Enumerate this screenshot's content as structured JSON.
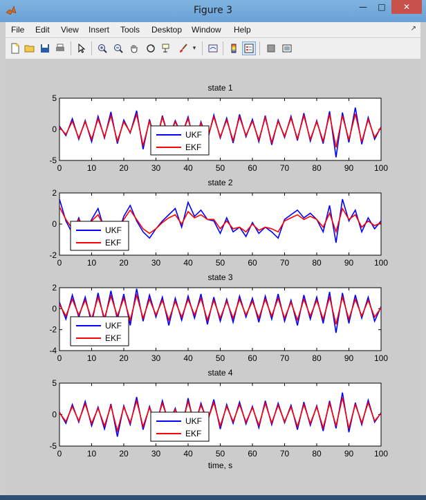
{
  "window": {
    "title": "Figure 3"
  },
  "menubar": {
    "items": [
      "File",
      "Edit",
      "View",
      "Insert",
      "Tools",
      "Desktop",
      "Window",
      "Help"
    ]
  },
  "toolbar": {
    "icons": [
      "new-figure-icon",
      "open-file-icon",
      "save-icon",
      "print-icon",
      "edit-plot-arrow-icon",
      "zoom-in-icon",
      "zoom-out-icon",
      "pan-hand-icon",
      "rotate-3d-icon",
      "data-cursor-icon",
      "brush-icon",
      "brush-dropdown-icon",
      "link-plot-icon",
      "insert-colorbar-icon",
      "insert-legend-icon",
      "hide-plot-tools-icon",
      "show-plot-tools-icon"
    ]
  },
  "colors": {
    "ukf": "#0000ff",
    "ekf": "#ff0000",
    "figure_bg": "#cccccc",
    "axes_bg": "#ffffff"
  },
  "chart_data": [
    {
      "type": "line",
      "title": "state 1",
      "xlabel": "",
      "xlim": [
        0,
        100
      ],
      "ylim": [
        -5,
        5
      ],
      "xticks": [
        0,
        10,
        20,
        30,
        40,
        50,
        60,
        70,
        80,
        90,
        100
      ],
      "yticks": [
        -5,
        0,
        5
      ],
      "legend": {
        "placement": "bottom-center"
      },
      "series": [
        {
          "name": "UKF",
          "color": "#0000ff",
          "x": [
            0,
            2,
            4,
            6,
            8,
            10,
            12,
            14,
            16,
            18,
            20,
            22,
            24,
            26,
            28,
            30,
            32,
            34,
            36,
            38,
            40,
            42,
            44,
            46,
            48,
            50,
            52,
            54,
            56,
            58,
            60,
            62,
            64,
            66,
            68,
            70,
            72,
            74,
            76,
            78,
            80,
            82,
            84,
            86,
            88,
            90,
            92,
            94,
            96,
            98,
            100
          ],
          "values": [
            0.5,
            -1.0,
            1.7,
            -1.6,
            1.4,
            -2.0,
            2.1,
            -1.4,
            2.8,
            -2.3,
            1.5,
            -0.6,
            3.0,
            -3.2,
            1.6,
            -2.4,
            2.2,
            -1.5,
            1.4,
            -1.0,
            2.0,
            -2.6,
            1.2,
            -1.8,
            2.3,
            -1.4,
            1.8,
            -2.2,
            2.4,
            -1.2,
            1.6,
            -2.0,
            2.2,
            -2.5,
            1.5,
            -1.3,
            2.1,
            -1.8,
            2.6,
            -1.9,
            1.4,
            -2.3,
            2.9,
            -4.5,
            2.7,
            -2.1,
            3.5,
            -2.4,
            1.9,
            -1.6,
            0.4
          ]
        },
        {
          "name": "EKF",
          "color": "#ff0000",
          "x": [
            0,
            2,
            4,
            6,
            8,
            10,
            12,
            14,
            16,
            18,
            20,
            22,
            24,
            26,
            28,
            30,
            32,
            34,
            36,
            38,
            40,
            42,
            44,
            46,
            48,
            50,
            52,
            54,
            56,
            58,
            60,
            62,
            64,
            66,
            68,
            70,
            72,
            74,
            76,
            78,
            80,
            82,
            84,
            86,
            88,
            90,
            92,
            94,
            96,
            98,
            100
          ],
          "values": [
            0.3,
            -0.8,
            1.3,
            -1.4,
            1.2,
            -1.6,
            1.7,
            -1.2,
            2.2,
            -1.9,
            1.2,
            -0.5,
            2.4,
            -2.6,
            1.3,
            -2.0,
            1.9,
            -1.3,
            1.2,
            -0.8,
            1.7,
            -2.1,
            1.0,
            -1.5,
            2.0,
            -1.2,
            1.5,
            -1.8,
            2.0,
            -1.0,
            1.3,
            -1.7,
            1.9,
            -2.1,
            1.3,
            -1.1,
            1.8,
            -1.5,
            2.2,
            -1.6,
            1.2,
            -1.9,
            2.4,
            -2.9,
            2.2,
            -1.7,
            2.5,
            -2.0,
            1.6,
            -1.3,
            0.3
          ]
        }
      ]
    },
    {
      "type": "line",
      "title": "state 2",
      "xlabel": "",
      "xlim": [
        0,
        100
      ],
      "ylim": [
        -2,
        2
      ],
      "xticks": [
        0,
        10,
        20,
        30,
        40,
        50,
        60,
        70,
        80,
        90,
        100
      ],
      "yticks": [
        -2,
        0,
        2
      ],
      "legend": {
        "placement": "bottom-left"
      },
      "series": [
        {
          "name": "UKF",
          "color": "#0000ff",
          "x": [
            0,
            2,
            4,
            6,
            8,
            10,
            12,
            14,
            16,
            18,
            20,
            22,
            24,
            26,
            28,
            30,
            32,
            34,
            36,
            38,
            40,
            42,
            44,
            46,
            48,
            50,
            52,
            54,
            56,
            58,
            60,
            62,
            64,
            66,
            68,
            70,
            72,
            74,
            76,
            78,
            80,
            82,
            84,
            86,
            88,
            90,
            92,
            94,
            96,
            98,
            100
          ],
          "values": [
            1.6,
            0.2,
            -0.6,
            0.4,
            -0.7,
            0.3,
            1.0,
            -0.4,
            -0.2,
            -0.8,
            0.5,
            1.2,
            0.2,
            -0.5,
            -0.9,
            -0.3,
            0.2,
            0.6,
            1.0,
            -0.2,
            1.4,
            0.5,
            0.9,
            0.3,
            0.2,
            -0.6,
            0.4,
            -0.5,
            -0.2,
            -0.8,
            0.1,
            -0.6,
            -0.2,
            -0.5,
            -0.9,
            0.3,
            0.6,
            0.9,
            0.4,
            0.7,
            0.3,
            -0.5,
            1.2,
            -1.2,
            1.6,
            0.2,
            0.9,
            -0.5,
            0.4,
            -0.3,
            0.2
          ]
        },
        {
          "name": "EKF",
          "color": "#ff0000",
          "x": [
            0,
            2,
            4,
            6,
            8,
            10,
            12,
            14,
            16,
            18,
            20,
            22,
            24,
            26,
            28,
            30,
            32,
            34,
            36,
            38,
            40,
            42,
            44,
            46,
            48,
            50,
            52,
            54,
            56,
            58,
            60,
            62,
            64,
            66,
            68,
            70,
            72,
            74,
            76,
            78,
            80,
            82,
            84,
            86,
            88,
            90,
            92,
            94,
            96,
            98,
            100
          ],
          "values": [
            1.1,
            0.3,
            -0.3,
            0.3,
            -0.4,
            0.2,
            0.6,
            -0.2,
            -0.2,
            -0.5,
            0.3,
            0.9,
            0.3,
            -0.3,
            -0.6,
            -0.3,
            0.1,
            0.4,
            0.6,
            0.0,
            0.8,
            0.4,
            0.6,
            0.3,
            0.3,
            -0.3,
            0.2,
            -0.3,
            -0.2,
            -0.5,
            0.0,
            -0.4,
            -0.2,
            -0.3,
            -0.5,
            0.2,
            0.4,
            0.6,
            0.3,
            0.5,
            0.3,
            -0.2,
            0.7,
            -0.5,
            1.0,
            0.3,
            0.6,
            -0.2,
            0.2,
            -0.1,
            0.1
          ]
        }
      ]
    },
    {
      "type": "line",
      "title": "state 3",
      "xlabel": "",
      "xlim": [
        0,
        100
      ],
      "ylim": [
        -4,
        2
      ],
      "xticks": [
        0,
        10,
        20,
        30,
        40,
        50,
        60,
        70,
        80,
        90,
        100
      ],
      "yticks": [
        -4,
        -2,
        0,
        2
      ],
      "legend": {
        "placement": "bottom-left"
      },
      "series": [
        {
          "name": "UKF",
          "color": "#0000ff",
          "x": [
            0,
            2,
            4,
            6,
            8,
            10,
            12,
            14,
            16,
            18,
            20,
            22,
            24,
            26,
            28,
            30,
            32,
            34,
            36,
            38,
            40,
            42,
            44,
            46,
            48,
            50,
            52,
            54,
            56,
            58,
            60,
            62,
            64,
            66,
            68,
            70,
            72,
            74,
            76,
            78,
            80,
            82,
            84,
            86,
            88,
            90,
            92,
            94,
            96,
            98,
            100
          ],
          "values": [
            0.6,
            -1.0,
            1.3,
            -0.8,
            1.1,
            -1.4,
            1.5,
            -1.2,
            1.7,
            -1.0,
            1.4,
            -1.6,
            1.9,
            -1.2,
            1.3,
            -0.8,
            1.1,
            -1.6,
            1.0,
            -1.1,
            1.2,
            -0.9,
            1.4,
            -1.5,
            1.1,
            -1.2,
            0.9,
            -1.3,
            1.2,
            -0.8,
            1.0,
            -1.3,
            1.2,
            -1.0,
            1.4,
            -1.2,
            0.8,
            -1.6,
            1.3,
            -1.0,
            1.1,
            -1.4,
            1.6,
            -2.3,
            1.5,
            -1.4,
            1.3,
            -0.9,
            1.1,
            -1.2,
            0.2
          ]
        },
        {
          "name": "EKF",
          "color": "#ff0000",
          "x": [
            0,
            2,
            4,
            6,
            8,
            10,
            12,
            14,
            16,
            18,
            20,
            22,
            24,
            26,
            28,
            30,
            32,
            34,
            36,
            38,
            40,
            42,
            44,
            46,
            48,
            50,
            52,
            54,
            56,
            58,
            60,
            62,
            64,
            66,
            68,
            70,
            72,
            74,
            76,
            78,
            80,
            82,
            84,
            86,
            88,
            90,
            92,
            94,
            96,
            98,
            100
          ],
          "values": [
            0.4,
            -0.7,
            0.9,
            -0.6,
            0.8,
            -1.0,
            1.1,
            -0.9,
            1.2,
            -0.7,
            1.0,
            -1.1,
            1.3,
            -0.9,
            0.9,
            -0.6,
            0.8,
            -1.1,
            0.7,
            -0.8,
            0.9,
            -0.6,
            1.0,
            -1.1,
            0.8,
            -0.9,
            0.7,
            -0.9,
            0.9,
            -0.6,
            0.7,
            -0.9,
            0.9,
            -0.7,
            1.0,
            -0.9,
            0.6,
            -1.1,
            0.9,
            -0.7,
            0.8,
            -1.0,
            1.1,
            -1.5,
            1.1,
            -1.0,
            0.9,
            -0.7,
            0.8,
            -0.8,
            0.1
          ]
        }
      ]
    },
    {
      "type": "line",
      "title": "state 4",
      "xlabel": "time, s",
      "xlim": [
        0,
        100
      ],
      "ylim": [
        -5,
        5
      ],
      "xticks": [
        0,
        10,
        20,
        30,
        40,
        50,
        60,
        70,
        80,
        90,
        100
      ],
      "yticks": [
        -5,
        0,
        5
      ],
      "legend": {
        "placement": "bottom-center"
      },
      "series": [
        {
          "name": "UKF",
          "color": "#0000ff",
          "x": [
            0,
            2,
            4,
            6,
            8,
            10,
            12,
            14,
            16,
            18,
            20,
            22,
            24,
            26,
            28,
            30,
            32,
            34,
            36,
            38,
            40,
            42,
            44,
            46,
            48,
            50,
            52,
            54,
            56,
            58,
            60,
            62,
            64,
            66,
            68,
            70,
            72,
            74,
            76,
            78,
            80,
            82,
            84,
            86,
            88,
            90,
            92,
            94,
            96,
            98,
            100
          ],
          "values": [
            0.4,
            -1.4,
            1.6,
            -1.2,
            2.1,
            -1.8,
            1.2,
            -2.3,
            1.7,
            -3.5,
            1.4,
            -1.6,
            2.8,
            -2.4,
            1.3,
            -1.9,
            2.2,
            -1.5,
            1.0,
            -2.3,
            2.6,
            -1.9,
            1.8,
            -1.2,
            2.4,
            -2.3,
            1.6,
            -1.4,
            2.0,
            -1.5,
            1.3,
            -2.1,
            2.2,
            -1.6,
            1.8,
            -1.3,
            1.5,
            -2.4,
            2.0,
            -1.7,
            1.4,
            -2.6,
            2.2,
            -2.2,
            3.5,
            -2.8,
            1.9,
            -1.6,
            2.3,
            -1.2,
            0.3
          ]
        },
        {
          "name": "EKF",
          "color": "#ff0000",
          "x": [
            0,
            2,
            4,
            6,
            8,
            10,
            12,
            14,
            16,
            18,
            20,
            22,
            24,
            26,
            28,
            30,
            32,
            34,
            36,
            38,
            40,
            42,
            44,
            46,
            48,
            50,
            52,
            54,
            56,
            58,
            60,
            62,
            64,
            66,
            68,
            70,
            72,
            74,
            76,
            78,
            80,
            82,
            84,
            86,
            88,
            90,
            92,
            94,
            96,
            98,
            100
          ],
          "values": [
            0.3,
            -1.1,
            1.3,
            -1.0,
            1.7,
            -1.4,
            1.0,
            -1.8,
            1.4,
            -2.6,
            1.2,
            -1.3,
            2.2,
            -1.9,
            1.1,
            -1.5,
            1.8,
            -1.2,
            0.8,
            -1.8,
            2.1,
            -1.5,
            1.5,
            -1.0,
            1.9,
            -1.8,
            1.3,
            -1.1,
            1.6,
            -1.2,
            1.1,
            -1.7,
            1.8,
            -1.3,
            1.5,
            -1.1,
            1.2,
            -1.9,
            1.6,
            -1.4,
            1.2,
            -2.1,
            1.8,
            -1.8,
            2.7,
            -2.2,
            1.6,
            -1.3,
            1.9,
            -1.0,
            0.2
          ]
        }
      ]
    }
  ]
}
